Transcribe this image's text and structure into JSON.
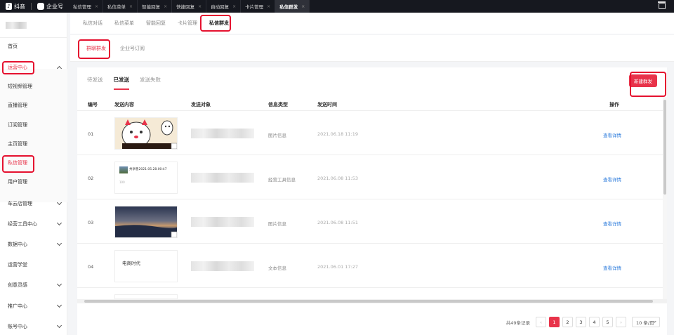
{
  "topbar": {
    "brand": "抖音",
    "brand2": "企业号",
    "tabs": [
      {
        "label": "私信管理"
      },
      {
        "label": "私信菜单"
      },
      {
        "label": "智能回复"
      },
      {
        "label": "快捷回复"
      },
      {
        "label": "自动回复"
      },
      {
        "label": "卡片管理"
      },
      {
        "label": "私信群发",
        "active": true
      }
    ],
    "close_glyph": "×"
  },
  "sidebar": {
    "home": "首页",
    "ops_center": "运营中心",
    "sub_items": [
      "短视频管理",
      "直播管理",
      "订阅管理",
      "主页管理",
      "私信管理",
      "用户管理"
    ],
    "sections": [
      "车云店管理",
      "经营工具中心",
      "数据中心",
      "运营学堂",
      "创意灵感",
      "推广中心",
      "账号中心"
    ]
  },
  "subtabs": [
    "私信对话",
    "私信菜单",
    "智能回复",
    "卡片管理",
    "私信群发"
  ],
  "group_tabs": [
    "群聊群发",
    "企业号订阅"
  ],
  "status_tabs": [
    "待发送",
    "已发送",
    "发送失败"
  ],
  "new_button": "新建群发",
  "table": {
    "headers": [
      "编号",
      "发送内容",
      "发送对象",
      "信息类型",
      "发送时间",
      "操作"
    ],
    "rows": [
      {
        "num": "01",
        "type": "图片信息",
        "time": "2021.06.18 11:19",
        "op": "查看详情"
      },
      {
        "num": "02",
        "type": "经营工具信息",
        "time": "2021.06.08 11:53",
        "op": "查看详情",
        "card_title": "共享售2021.05.28.00:47",
        "card_sub": "100"
      },
      {
        "num": "03",
        "type": "图片信息",
        "time": "2021.06.08 11:51",
        "op": "查看详情"
      },
      {
        "num": "04",
        "type": "文本信息",
        "time": "2021.06.01 17:27",
        "op": "查看详情",
        "text": "电商时代"
      }
    ]
  },
  "pagination": {
    "total": "共49条记录",
    "pages": [
      "1",
      "2",
      "3",
      "4",
      "5"
    ],
    "prev": "‹",
    "next": "›",
    "page_size": "10 条/页"
  },
  "colors": {
    "accent": "#e8334a",
    "link": "#2f7ddc",
    "highlight_box": "#e5112f"
  }
}
